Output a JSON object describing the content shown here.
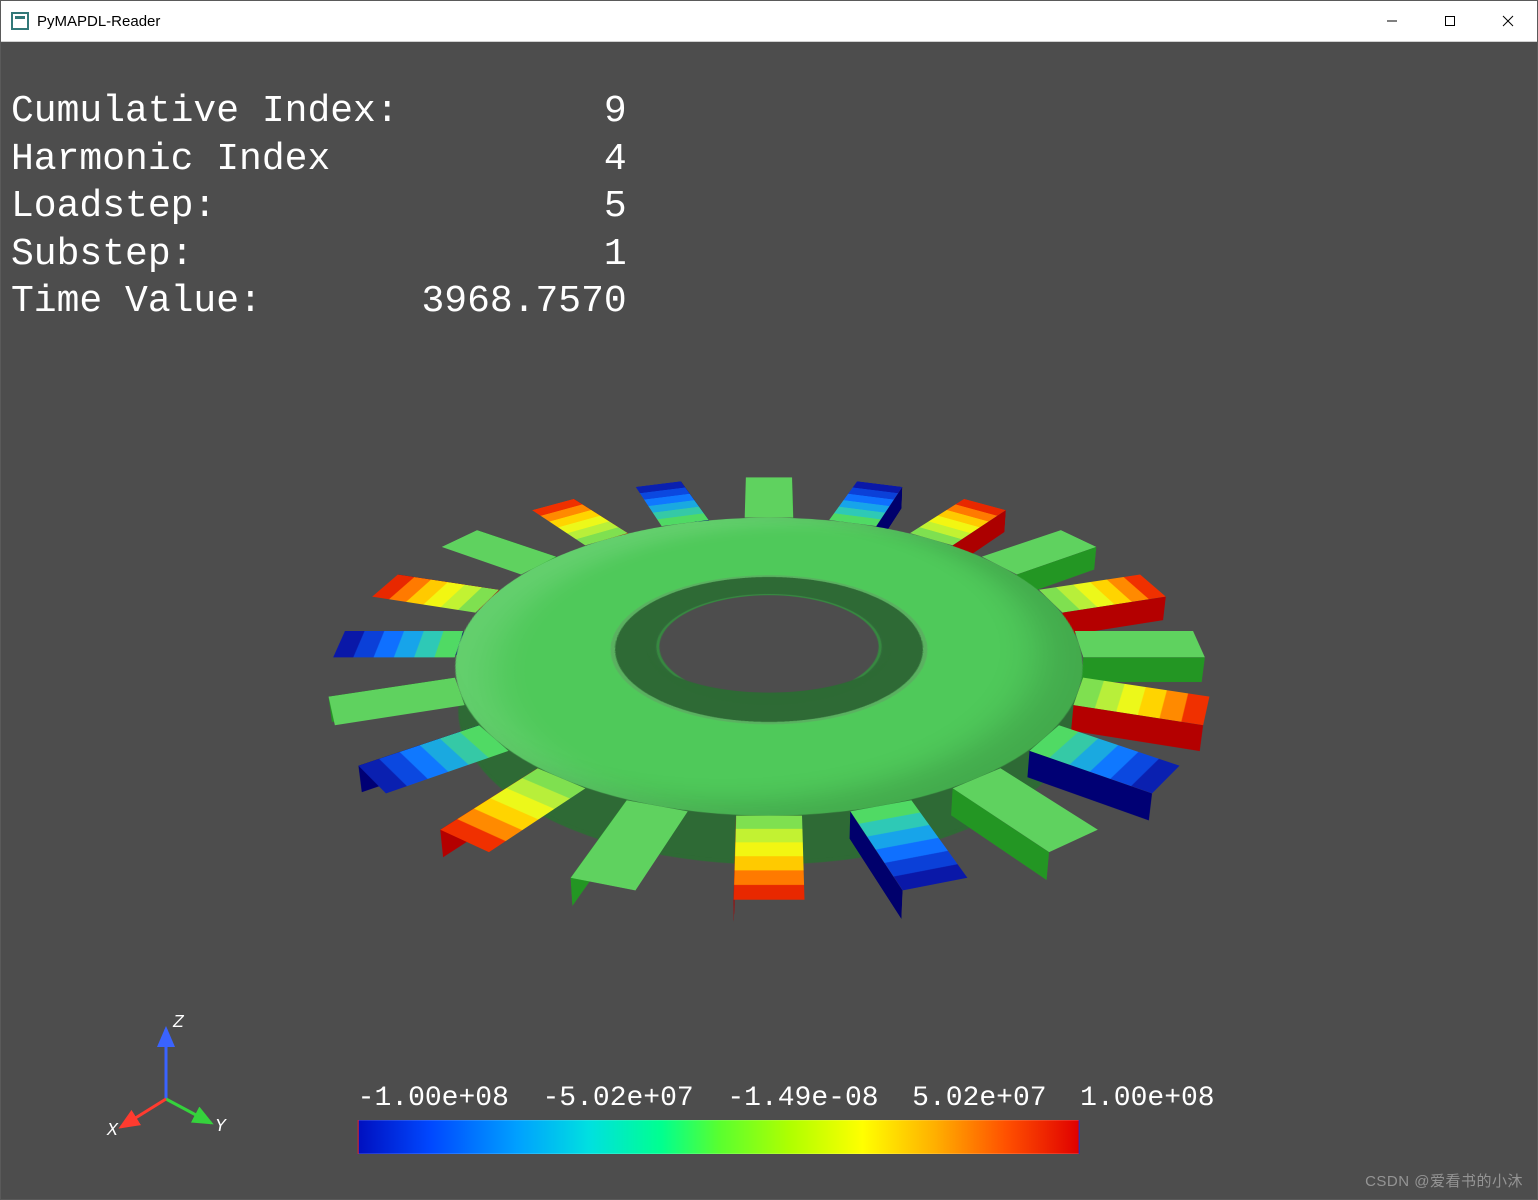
{
  "window": {
    "title": "PyMAPDL-Reader"
  },
  "overlay": {
    "lines": [
      {
        "label": "Cumulative Index:",
        "value": "9"
      },
      {
        "label": "Harmonic Index",
        "value": "4"
      },
      {
        "label": "Loadstep:",
        "value": "5"
      },
      {
        "label": "Substep:",
        "value": "1"
      },
      {
        "label": "Time Value:",
        "value": "3968.7570"
      }
    ]
  },
  "axis_triad": {
    "x": "X",
    "y": "Y",
    "z": "Z"
  },
  "colorbar": {
    "ticks": [
      "-1.00e+08",
      "-5.02e+07",
      "-1.49e-08",
      "5.02e+07",
      "1.00e+08"
    ],
    "gradient": [
      "#0010c0",
      "#00a0ff",
      "#00ff90",
      "#ffff00",
      "#ff5000",
      "#e00000"
    ]
  },
  "model": {
    "blade_count": 20,
    "blade_palettes": [
      [
        "#5fd25f",
        "#5fd25f",
        "#5fd25f",
        "#5fd25f",
        "#5fd25f",
        "#5fd25f"
      ],
      [
        "#7fe050",
        "#b8ef3a",
        "#ecf81a",
        "#ffd400",
        "#ff8a00",
        "#f03000"
      ],
      [
        "#50da64",
        "#35c9a6",
        "#1aa9e0",
        "#0f78ff",
        "#0b48e0",
        "#0a20b0"
      ],
      [
        "#50da64",
        "#2ec9b6",
        "#17a4ea",
        "#0f70ff",
        "#0b40d8",
        "#0a18a8"
      ],
      [
        "#7fe050",
        "#c2f232",
        "#f2f612",
        "#ffca00",
        "#ff7a00",
        "#e82800"
      ]
    ],
    "palette_sequence": [
      0,
      1,
      2,
      0,
      3,
      4,
      0,
      1,
      2,
      0,
      3,
      4,
      0,
      1,
      2,
      0,
      3,
      4,
      0,
      1
    ]
  },
  "watermark": "CSDN @爱看书的小沐"
}
